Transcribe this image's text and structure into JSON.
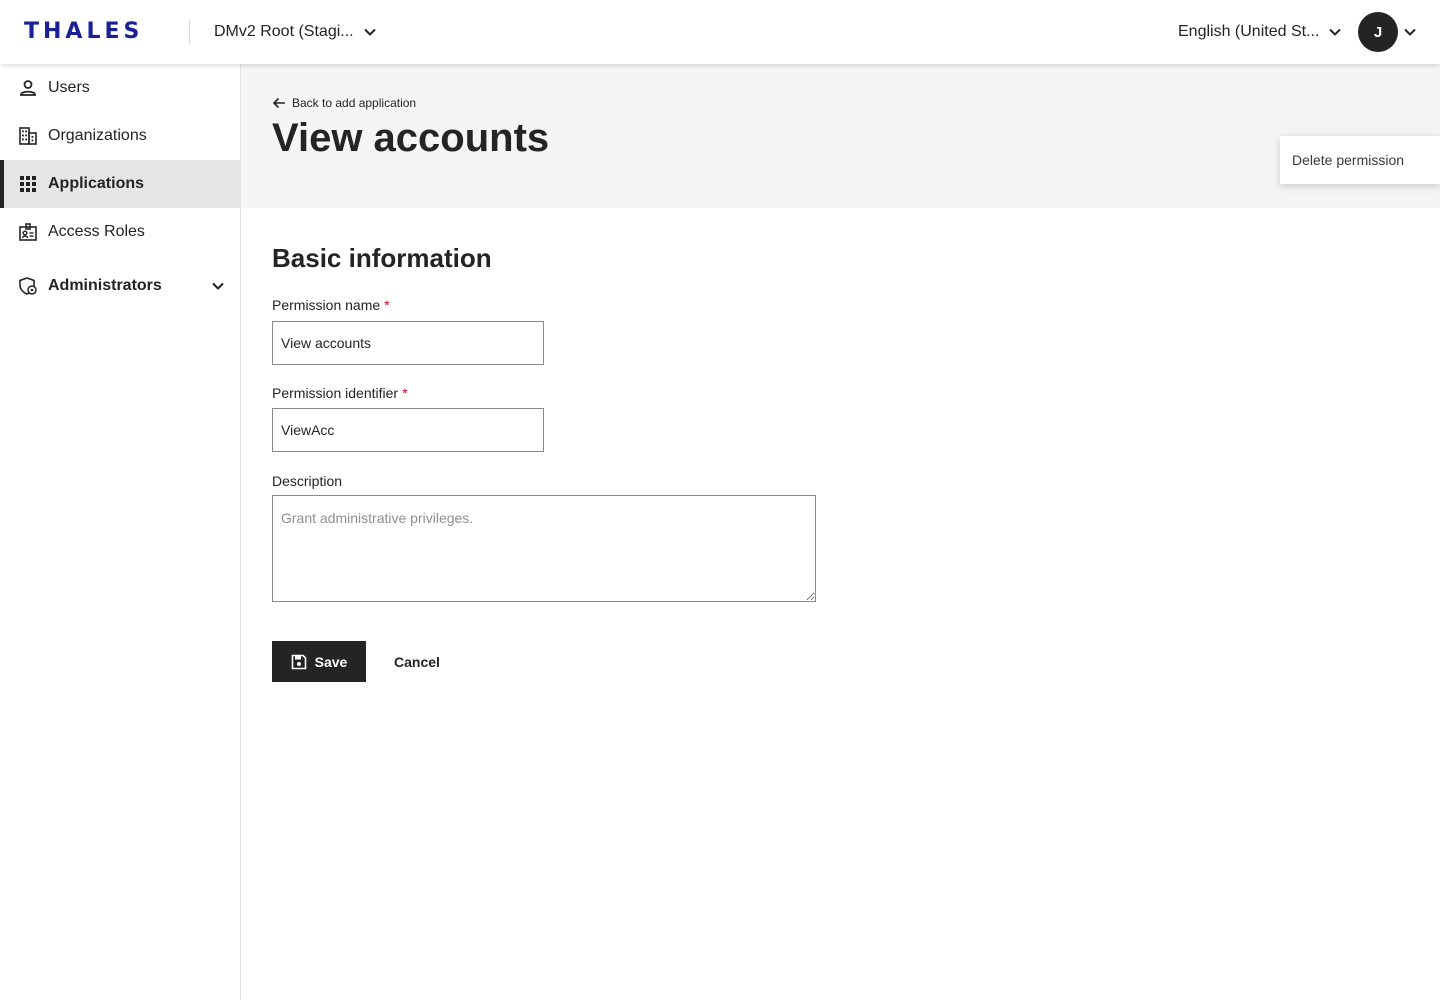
{
  "topbar": {
    "logo": "THALES",
    "tenant_label": "DMv2 Root (Stagi...",
    "language_label": "English (United St...",
    "avatar_initial": "J"
  },
  "sidebar": {
    "items": [
      {
        "label": "Users",
        "icon": "user-icon"
      },
      {
        "label": "Organizations",
        "icon": "building-icon"
      },
      {
        "label": "Applications",
        "icon": "apps-grid-icon",
        "active": true
      },
      {
        "label": "Access Roles",
        "icon": "id-badge-icon"
      },
      {
        "label": "Administrators",
        "icon": "admin-shield-icon",
        "expandable": true
      }
    ]
  },
  "header": {
    "back_link": "Back to add application",
    "title": "View accounts",
    "menu_item": "Delete permission"
  },
  "form": {
    "section_title": "Basic information",
    "permission_name": {
      "label": "Permission name",
      "required_mark": "*",
      "value": "View accounts"
    },
    "permission_identifier": {
      "label": "Permission identifier",
      "required_mark": "*",
      "value": "ViewAcc"
    },
    "description": {
      "label": "Description",
      "placeholder": "Grant administrative privileges.",
      "value": ""
    },
    "save_label": "Save",
    "cancel_label": "Cancel"
  },
  "colors": {
    "brand": "#1a2196",
    "dark": "#242424",
    "active_bg": "#e6e6e6",
    "header_bg": "#f5f5f5",
    "required": "#d0021b"
  }
}
